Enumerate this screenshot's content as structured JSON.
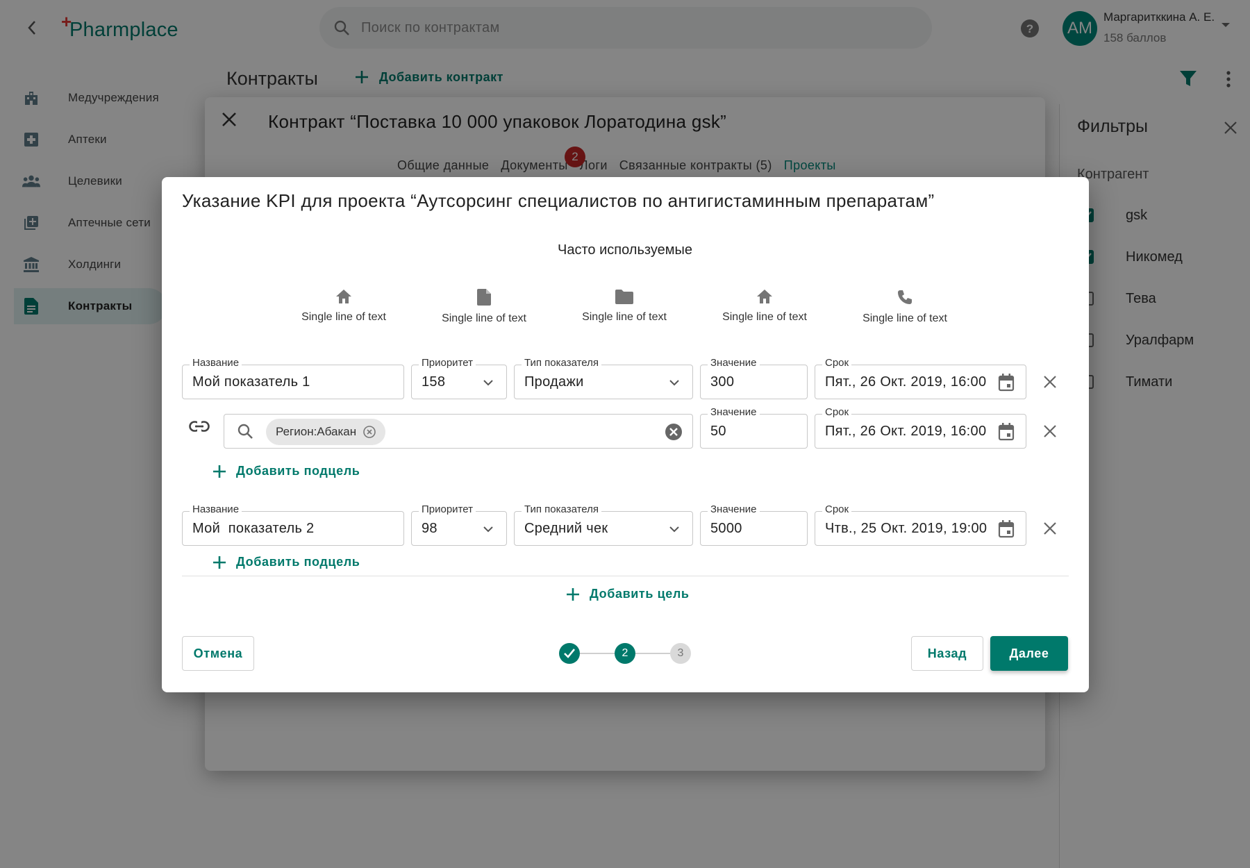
{
  "app": {
    "logo_text": "Pharmplace",
    "search_placeholder": "Поиск по контрактам",
    "user": {
      "initials": "AM",
      "name": "Маргаритккина А. Е.",
      "points": "158 баллов"
    }
  },
  "sidebar": {
    "items": [
      {
        "label": "Медучреждения",
        "icon": "hospital-icon"
      },
      {
        "label": "Аптеки",
        "icon": "pharmacy-cross-icon"
      },
      {
        "label": "Целевики",
        "icon": "people-icon"
      },
      {
        "label": "Аптечные сети",
        "icon": "library-add-icon"
      },
      {
        "label": "Холдинги",
        "icon": "bank-icon"
      },
      {
        "label": "Контракты",
        "icon": "document-icon",
        "active": true
      }
    ]
  },
  "page": {
    "title": "Контракты",
    "add_contract_label": "Добавить контракт"
  },
  "filters": {
    "title": "Фильтры",
    "subtitle": "Контрагент",
    "options": [
      {
        "label": "gsk",
        "checked": true
      },
      {
        "label": "Никомед",
        "checked": true
      },
      {
        "label": "Тева",
        "checked": false
      },
      {
        "label": "Уралфарм",
        "checked": false
      },
      {
        "label": "Тимати",
        "checked": false
      }
    ]
  },
  "contract_dialog": {
    "title": "Контракт “Поставка 10 000 упаковок Лоратодина gsk”",
    "tabs": [
      {
        "label": "Общие данные"
      },
      {
        "label": "Документы"
      },
      {
        "label": "Логи"
      },
      {
        "label": "Связанные контракты (5)"
      },
      {
        "label": "Проекты",
        "active": true
      }
    ],
    "documents_badge": "2"
  },
  "kpi_modal": {
    "title": "Указание KPI для проекта “Аутсорсинг специалистов по антигистаминным препаратам”",
    "frequent_title": "Часто используемые",
    "frequent": [
      {
        "label": "Single line of text",
        "icon": "home-icon"
      },
      {
        "label": "Single line of text",
        "icon": "file-icon"
      },
      {
        "label": "Single line of text",
        "icon": "folder-icon"
      },
      {
        "label": "Single line of text",
        "icon": "home-icon"
      },
      {
        "label": "Single line of text",
        "icon": "phone-icon"
      }
    ],
    "labels": {
      "name": "Название",
      "priority": "Приоритет",
      "type": "Тип показателя",
      "value": "Значение",
      "deadline": "Срок"
    },
    "goals": [
      {
        "name": "Мой показатель 1",
        "priority": "158",
        "type": "Продажи",
        "value": "300",
        "deadline": "Пят., 26 Окт. 2019, 16:00",
        "subgoal": {
          "chip": "Регион:Абакан",
          "value": "50",
          "deadline": "Пят., 26 Окт. 2019, 16:00"
        }
      },
      {
        "name": "Мой  показатель 2",
        "priority": "98",
        "type": "Средний чек",
        "value": "5000",
        "deadline": "Чтв., 25 Окт. 2019, 19:00"
      }
    ],
    "add_subgoal_label": "Добавить подцель",
    "add_goal_label": "Добавить цель",
    "cancel_label": "Отмена",
    "back_label": "Назад",
    "next_label": "Далее",
    "stepper": {
      "current": 2,
      "total": 3,
      "labels": [
        "",
        "2",
        "3"
      ]
    },
    "accent_color": "#00796b"
  }
}
